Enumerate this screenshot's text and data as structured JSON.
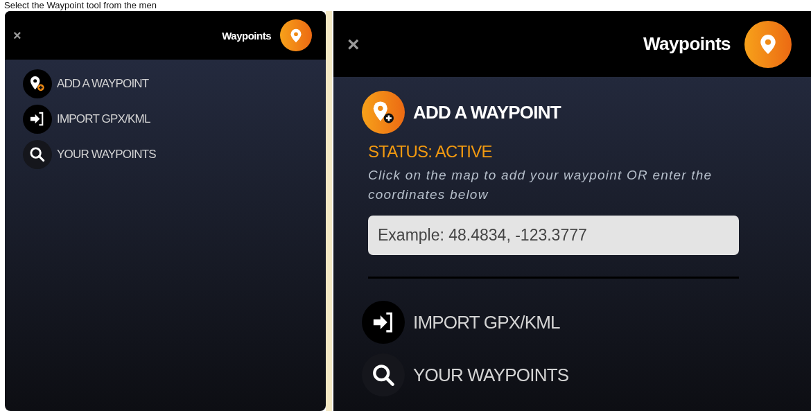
{
  "caption": "Select the Waypoint tool from the men",
  "panels": [
    {
      "close": "×",
      "title": "Waypoints",
      "items": [
        {
          "kind": "add",
          "label": "ADD A WAYPOINT",
          "expanded": false
        },
        {
          "kind": "import",
          "label": "IMPORT GPX/KML",
          "expanded": false
        },
        {
          "kind": "search",
          "label": "YOUR WAYPOINTS",
          "expanded": false
        }
      ]
    },
    {
      "close": "×",
      "title": "Waypoints",
      "items": [
        {
          "kind": "add",
          "label": "ADD A WAYPOINT",
          "expanded": true,
          "status": "STATUS: ACTIVE",
          "instructions": "Click on the map to add your waypoint OR enter the coordinates below",
          "placeholder": "Example: 48.4834, -123.3777"
        },
        {
          "kind": "import",
          "label": "IMPORT GPX/KML",
          "expanded": false
        },
        {
          "kind": "search",
          "label": "YOUR WAYPOINTS",
          "expanded": false
        }
      ]
    }
  ]
}
